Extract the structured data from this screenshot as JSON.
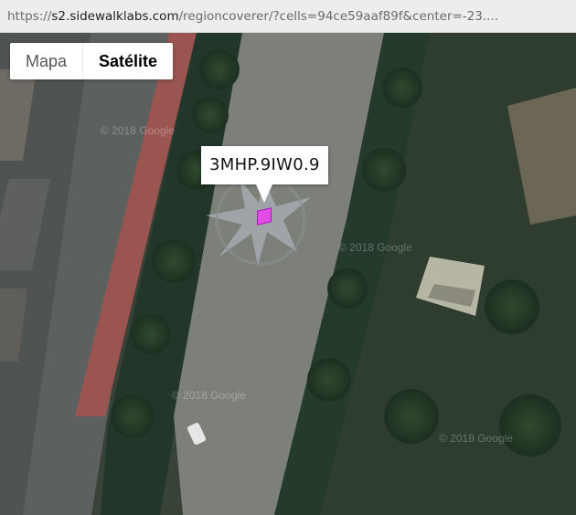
{
  "browser": {
    "url_scheme": "https://",
    "url_host": "s2.sidewalklabs.com",
    "url_path": "/regioncoverer/?cells=94ce59aaf89f&center=-23...."
  },
  "map": {
    "map_type_control": {
      "options": [
        "Mapa",
        "Satélite"
      ],
      "selected": "Satélite"
    },
    "marker_label": "3MHP.9IW0.9",
    "cell_color": "#e24be6",
    "watermark_text": "© 2018 Google"
  }
}
